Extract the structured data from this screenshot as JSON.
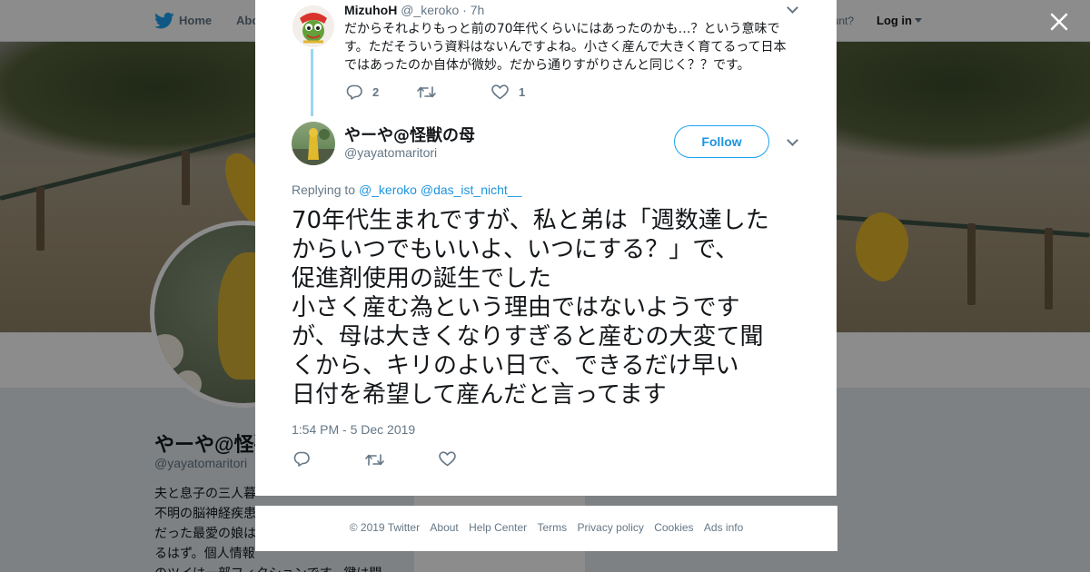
{
  "nav": {
    "home_label": "Home",
    "about_label": "Abo",
    "account_prompt": "ccount?",
    "login_label": "Log in"
  },
  "profile": {
    "name": "やーや@怪獣",
    "handle": "@yayatomaritori",
    "bio_lines": [
      "夫と息子の三人暮",
      "不明の脳神経疾患",
      "だった最愛の娘は",
      "るはず。個人情報",
      "のツイは一部フィクションです。鍵は開"
    ]
  },
  "modal": {
    "parent_tweet": {
      "author_name": "MizuhoH",
      "author_handle": "@_keroko",
      "time": "7h",
      "text_lines": [
        "だからそれよりもっと前の70年代くらいにはあったのかも…？という意味で",
        "す。ただそういう資料はないんですよね。小さく産んで大きく育てるって日本",
        "ではあったのか自体が微妙。だから通りすがりさんと同じく？？です。"
      ],
      "reply_count": "2",
      "retweet_count": "",
      "like_count": "1"
    },
    "main_tweet": {
      "author_name": "やーや@怪獣の母",
      "author_handle": "@yayatomaritori",
      "follow_label": "Follow",
      "replying_prefix": "Replying to",
      "replying_to": [
        "@_keroko",
        "@das_ist_nicht__"
      ],
      "text_lines": [
        "70年代生まれですが、私と弟は「週数達した",
        "からいつでもいいよ、いつにする？」で、",
        "促進剤使用の誕生でした",
        "小さく産む為という理由ではないようです",
        "が、母は大きくなりすぎると産むの大変て聞",
        "くから、キリのよい日で、できるだけ早い",
        "日付を希望して産んだと言ってます"
      ],
      "timestamp": "1:54 PM - 5 Dec 2019"
    }
  },
  "footer": {
    "links": [
      "© 2019 Twitter",
      "About",
      "Help Center",
      "Terms",
      "Privacy policy",
      "Cookies",
      "Ads info"
    ]
  },
  "colors": {
    "accent": "#1da1f2",
    "link": "#1b95e0",
    "muted": "#657786",
    "thread_line": "#9ad6f1"
  }
}
